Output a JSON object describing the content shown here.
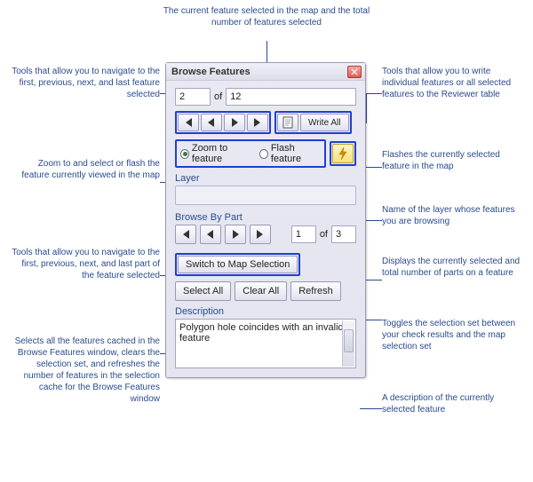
{
  "top_note": "The current feature selected in the map and the total number of features selected",
  "dialog": {
    "title": "Browse Features",
    "current_index": "2",
    "of_label": "of",
    "total": "12",
    "write_all_label": "Write All",
    "zoom_label": "Zoom to feature",
    "flash_label": "Flash feature",
    "layer_label": "Layer",
    "layer_value": "",
    "browse_by_part_label": "Browse By Part",
    "part_current": "1",
    "part_of_label": "of",
    "part_total": "3",
    "switch_label": "Switch to Map Selection",
    "select_all_label": "Select All",
    "clear_all_label": "Clear All",
    "refresh_label": "Refresh",
    "description_label": "Description",
    "description_value": "Polygon hole coincides with an invalid feature"
  },
  "left_notes": {
    "nav_feature": "Tools that allow you to navigate to the first, previous, next, and last feature selected",
    "zoom_flash": "Zoom to and select or flash the feature currently viewed in the map",
    "nav_part": "Tools that allow you to navigate to the first, previous, next, and last part of the feature selected",
    "cache_ops": "Selects all the features cached in the Browse Features window, clears the selection set, and refreshes the number of features in the selection cache for the Browse Features window"
  },
  "right_notes": {
    "write": "Tools that allow you to write individual features or all selected features to the Reviewer table",
    "zap": "Flashes the currently selected feature in the map",
    "layer": "Name of the layer whose features you are browsing",
    "parts": "Displays the currently selected and total number of parts on a feature",
    "switch": "Toggles the selection set between your check results and the map selection set",
    "desc": "A description of the currently selected feature"
  }
}
